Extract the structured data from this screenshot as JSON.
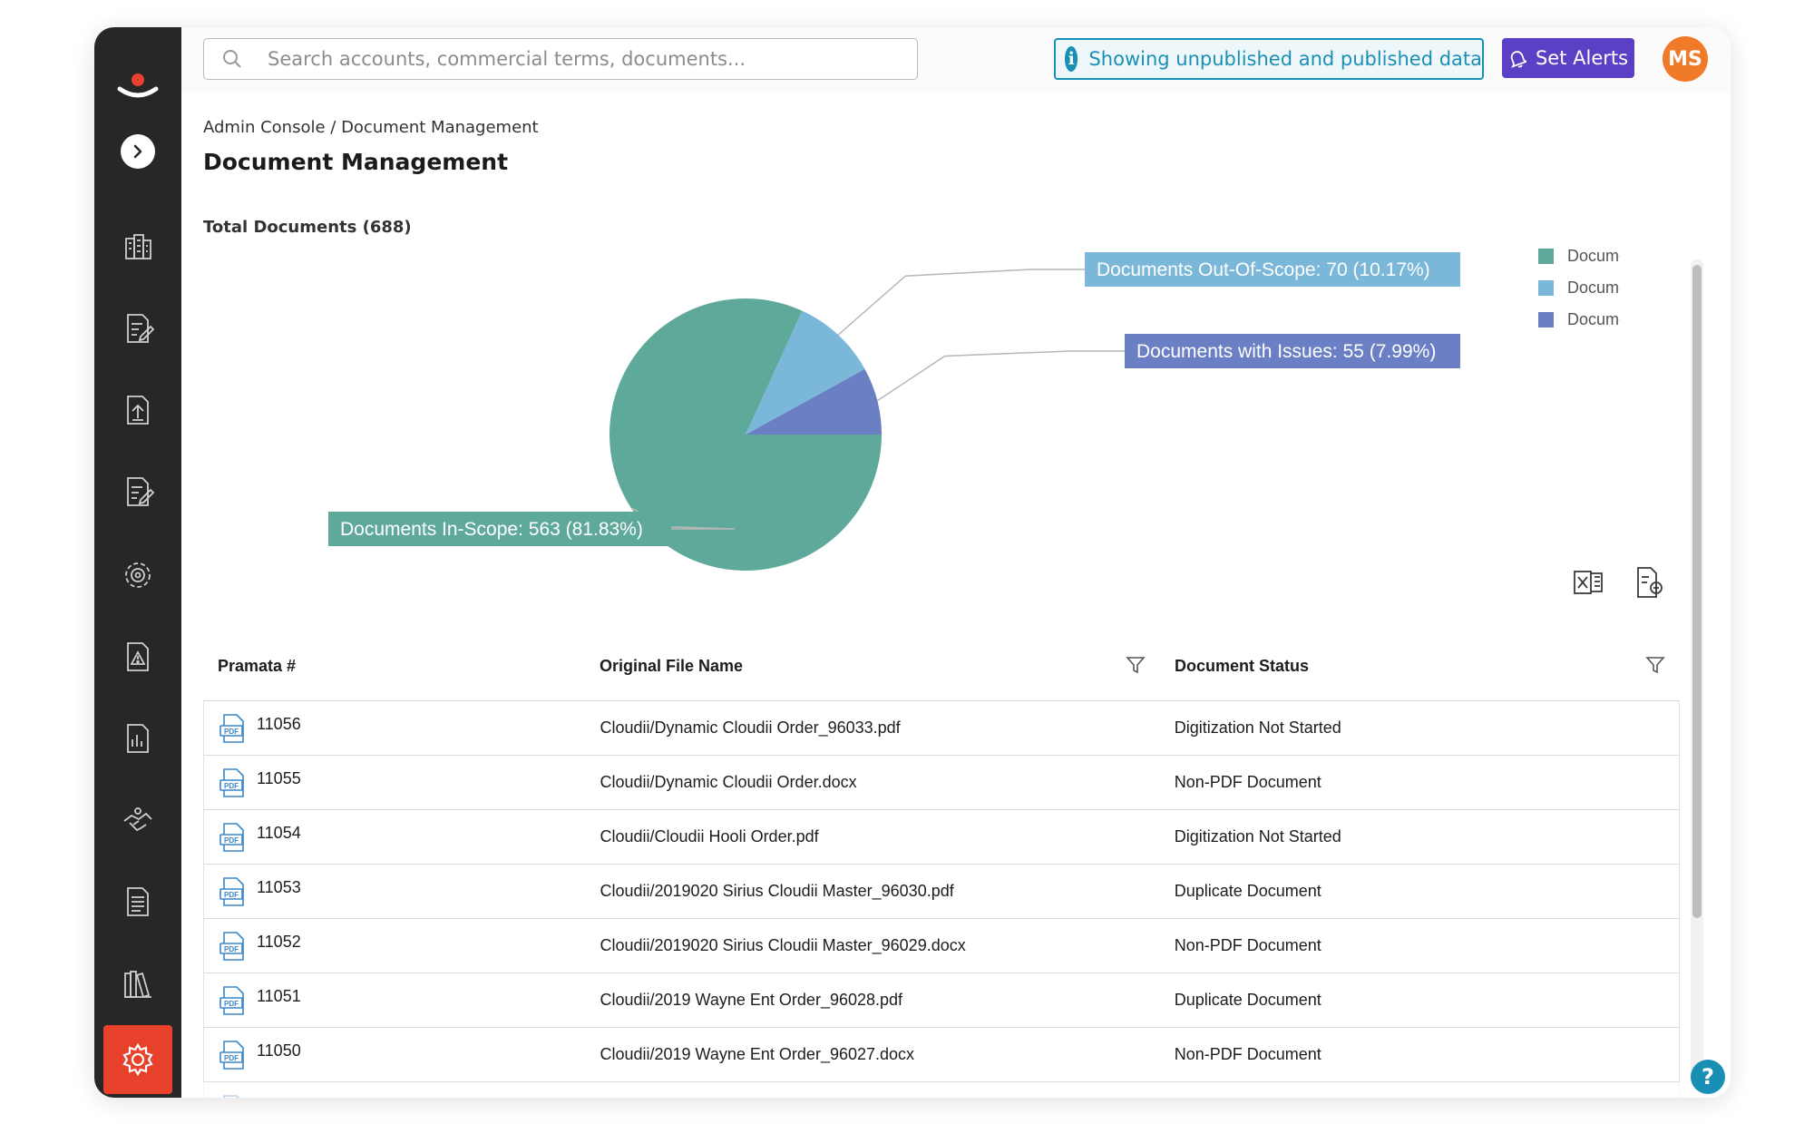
{
  "search": {
    "placeholder": "Search accounts, commercial terms, documents..."
  },
  "header": {
    "data_notice": "Showing unpublished and published data",
    "alerts_label": "Set Alerts",
    "user_initials": "MS"
  },
  "breadcrumb": {
    "parent": "Admin Console",
    "separator": " / ",
    "current": "Document Management"
  },
  "page": {
    "title": "Document Management",
    "total_label": "Total Documents (688)"
  },
  "sidebar": {
    "items": [
      {
        "icon": "buildings-icon"
      },
      {
        "icon": "document-edit-icon"
      },
      {
        "icon": "document-upload-icon"
      },
      {
        "icon": "document-edit-icon"
      },
      {
        "icon": "gear-badge-icon"
      },
      {
        "icon": "warning-document-icon"
      },
      {
        "icon": "report-icon"
      },
      {
        "icon": "handshake-icon"
      },
      {
        "icon": "document-list-icon"
      },
      {
        "icon": "library-icon"
      }
    ],
    "active_icon": "settings-icon"
  },
  "chart_data": {
    "type": "pie",
    "total": 688,
    "slices": [
      {
        "name": "Documents In-Scope",
        "value": 563,
        "percent": 81.83,
        "label": "Documents In-Scope: 563 (81.83%)",
        "color": "#5fa99b"
      },
      {
        "name": "Documents Out-Of-Scope",
        "value": 70,
        "percent": 10.17,
        "label": "Documents Out-Of-Scope: 70 (10.17%)",
        "color": "#7ab7d9"
      },
      {
        "name": "Documents with Issues",
        "value": 55,
        "percent": 7.99,
        "label": "Documents with Issues: 55 (7.99%)",
        "color": "#6b7fc4"
      }
    ],
    "legend": [
      "Documents In-Scope",
      "Documents Out-Of-Scope",
      "Documents with Issues"
    ],
    "legend_position": "top-right"
  },
  "table": {
    "columns": [
      "Pramata #",
      "Original File Name",
      "Document Status"
    ],
    "rows": [
      {
        "id": "11056",
        "file": "Cloudii/Dynamic Cloudii Order_96033.pdf",
        "status": "Digitization Not Started"
      },
      {
        "id": "11055",
        "file": "Cloudii/Dynamic Cloudii Order.docx",
        "status": "Non-PDF Document"
      },
      {
        "id": "11054",
        "file": "Cloudii/Cloudii Hooli Order.pdf",
        "status": "Digitization Not Started"
      },
      {
        "id": "11053",
        "file": "Cloudii/2019020 Sirius Cloudii Master_96030.pdf",
        "status": "Duplicate Document"
      },
      {
        "id": "11052",
        "file": "Cloudii/2019020 Sirius Cloudii Master_96029.docx",
        "status": "Non-PDF Document"
      },
      {
        "id": "11051",
        "file": "Cloudii/2019 Wayne Ent Order_96028.pdf",
        "status": "Duplicate Document"
      },
      {
        "id": "11050",
        "file": "Cloudii/2019 Wayne Ent Order_96027.docx",
        "status": "Non-PDF Document"
      }
    ]
  },
  "colors": {
    "accent": "#1a8fb5",
    "alerts": "#5b3fc4",
    "avatar": "#f07a28",
    "active_nav": "#e8412c",
    "sidebar": "#272727"
  },
  "help_label": "?"
}
